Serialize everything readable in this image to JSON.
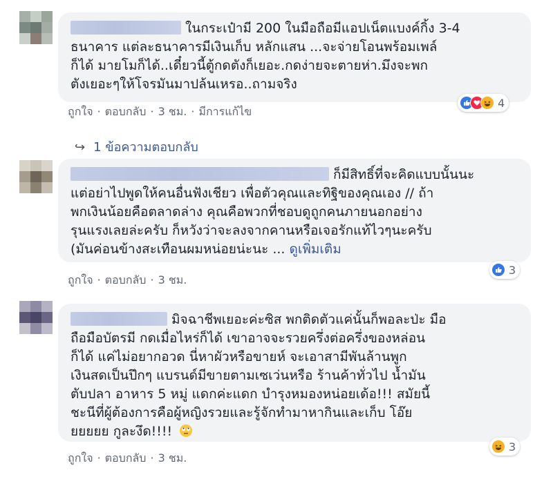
{
  "comments": [
    {
      "lines": [
        "ในกระเป๋ามี 200 ในมือถือมีแอปเน็ตแบงค์กิ้ง 3-4",
        "ธนาคาร แต่ละธนาคารมีเงินเก็บ หลักแสน ...จะจ่ายโอนพร้อมเพล์",
        "ก็ได้ มายโมก็ได้..เดี๋ยวนี้ตู้กดตังก็เยอะ.กดง่ายจะตายห่า.มึงจะพก",
        "ตังเยอะๆให้โจรมันมาปล้นเหรอ..ถามจริง"
      ],
      "like": "ถูกใจ",
      "reply": "ตอบกลับ",
      "time": "3 ชม.",
      "edited": "มีการแก้ไข",
      "reaction_count": "4"
    },
    {
      "lines": [
        "ก็มีสิทธิ์ที่จะคิดแบบนั้นนะ",
        "แต่อย่าไปพูดให้คนอื่นฟังเชียว เพื่อตัวคุณและทิฐิของคุณเอง // ถ้า",
        "พกเงินน้อยคือตลาดล่าง คุณคือพวกที่ชอบดูถูกคนภายนอกอย่าง",
        "รุนแรงเลยล่ะครับ ก็หวังว่าจะลงจากคานหรือเจอรักแท้ไวๆนะครับ",
        "(มันค่อนข้างสะเทือนผมหน่อยน่ะนะ ..."
      ],
      "see_more": "ดูเพิ่มเติม",
      "like": "ถูกใจ",
      "reply": "ตอบกลับ",
      "time": "3 ชม.",
      "reaction_count": "3"
    },
    {
      "lines": [
        "มิจฉาชีพเยอะค่ะซิส พกติดตัวแค่นั้นก็พอละป่ะ มือ",
        "ถือมือบัตรมี กดเมื่อไหร่ก็ได้ เขาอาจจะรวยครึ่งต่อครึ่งของหล่อน",
        "ก็ได้ แค่ไม่อยากอวด นี่หาผัวหรือขายห์ จะเอาสามีพันล้านพูก",
        "เงินสดเป็นปึกๆ แบรนด์มีขายตามเซเว่นหรือ ร้านค้าทั่วไป น้ำมัน",
        "ตับปลา อาหาร 5 หมู่ แดกค่ะแดก บำรุงหมองหน่อยเด้อ!!! สมัยนี้",
        "ชะนีที่ผู้ต้องการคือผู้หญิงรวยและรู้จักทำมาหากินและเก็บ โอ๊ย",
        "ยยยยย กูละงึด!!!!"
      ],
      "like": "ถูกใจ",
      "reply": "ตอบกลับ",
      "time": "3 ชม.",
      "reaction_count": "3"
    }
  ],
  "replies_link": "1 ข้อความตอบกลับ",
  "colors": {
    "link": "#385898",
    "bubble": "#f2f3f5",
    "meta": "#606770"
  }
}
